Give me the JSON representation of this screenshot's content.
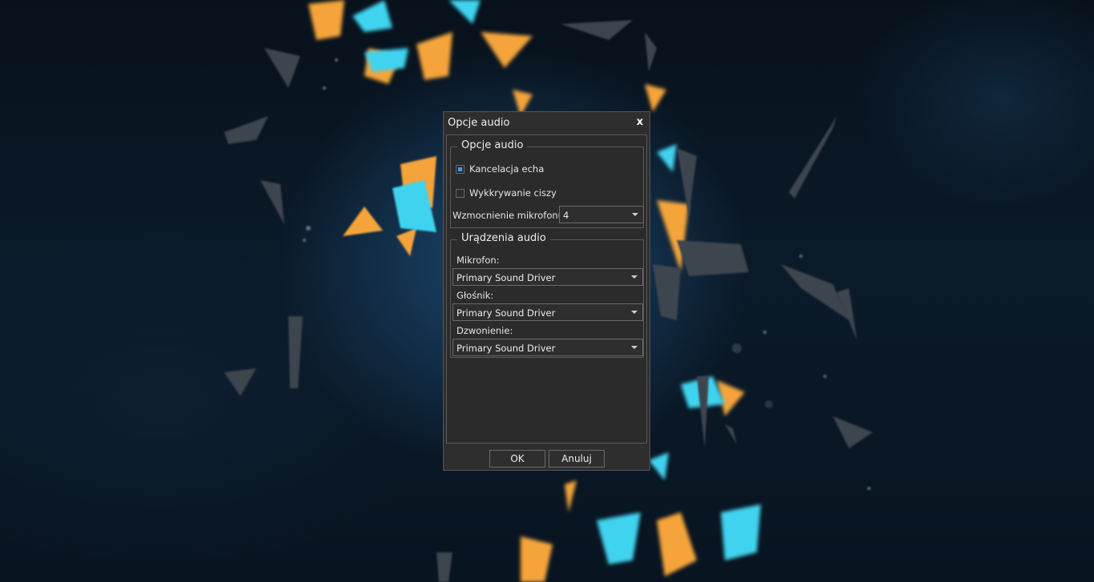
{
  "dialog": {
    "title": "Opcje audio",
    "close_label": "x"
  },
  "audio_options": {
    "legend": "Opcje audio",
    "echo_cancel": {
      "label": "Kancelacja echa",
      "checked": true
    },
    "silence_detect": {
      "label": "Wykkrywanie ciszy",
      "checked": false
    },
    "mic_gain": {
      "label": "Wzmocnienie mikrofonu",
      "value": "4"
    }
  },
  "audio_devices": {
    "legend": "Urądzenia audio",
    "microphone": {
      "label": "Mikrofon:",
      "value": "Primary Sound Driver"
    },
    "speaker": {
      "label": "Głośnik:",
      "value": "Primary Sound Driver"
    },
    "ringing": {
      "label": "Dzwonienie:",
      "value": "Primary Sound Driver"
    }
  },
  "buttons": {
    "ok_label": "OK",
    "cancel_label": "Anuluj"
  },
  "colors": {
    "accent": "#3aa0ff",
    "dialog_bg": "#2e2e2e",
    "shard_orange": "#f4a43a",
    "shard_cyan": "#3fd3ef"
  }
}
